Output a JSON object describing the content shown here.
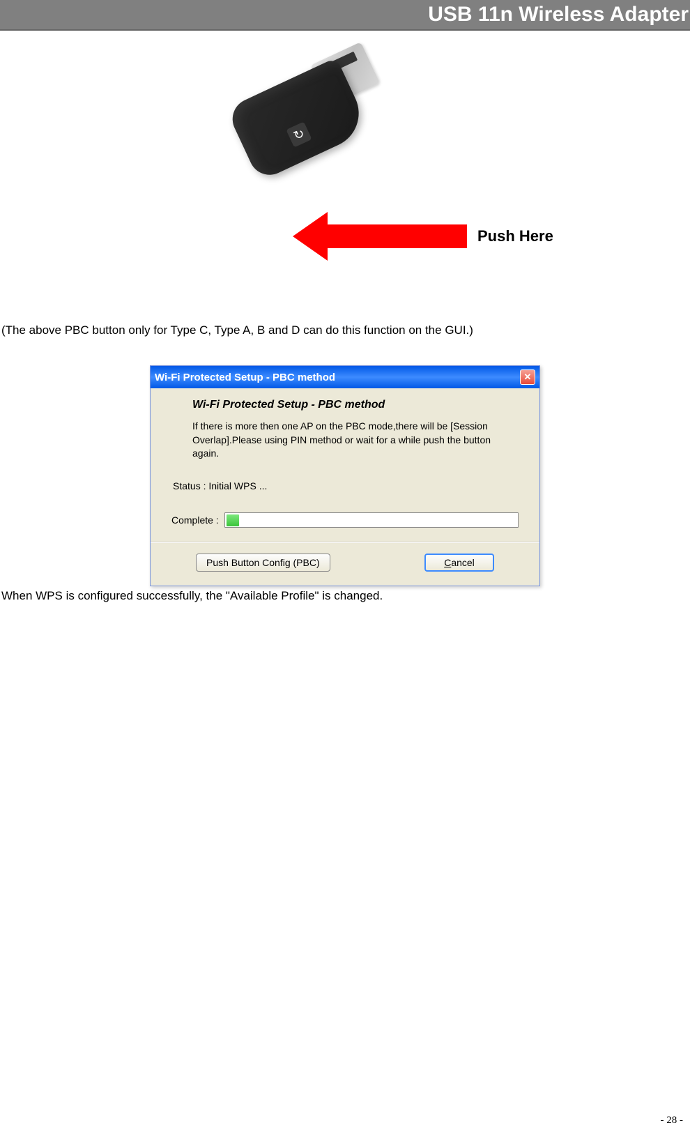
{
  "header": {
    "title": "USB 11n Wireless Adapter"
  },
  "pushHere": "Push Here",
  "caption": "(The above PBC button only for Type C, Type A, B and D can do this function on the GUI.)",
  "dialog": {
    "title": "Wi-Fi Protected Setup - PBC method",
    "heading": "Wi-Fi Protected Setup - PBC method",
    "body": "If there is more then one AP on the PBC mode,there will be [Session Overlap].Please using PIN method or wait for a while push the button again.",
    "statusLabel": "Status :",
    "statusValue": "Initial WPS ...",
    "completeLabel": "Complete :",
    "buttons": {
      "pbc": "Push Button Config (PBC)",
      "cancelPre": "C",
      "cancelPost": "ancel"
    }
  },
  "footerText": "When WPS is configured successfully, the \"Available Profile\" is changed.",
  "pageNumber": "- 28 -"
}
